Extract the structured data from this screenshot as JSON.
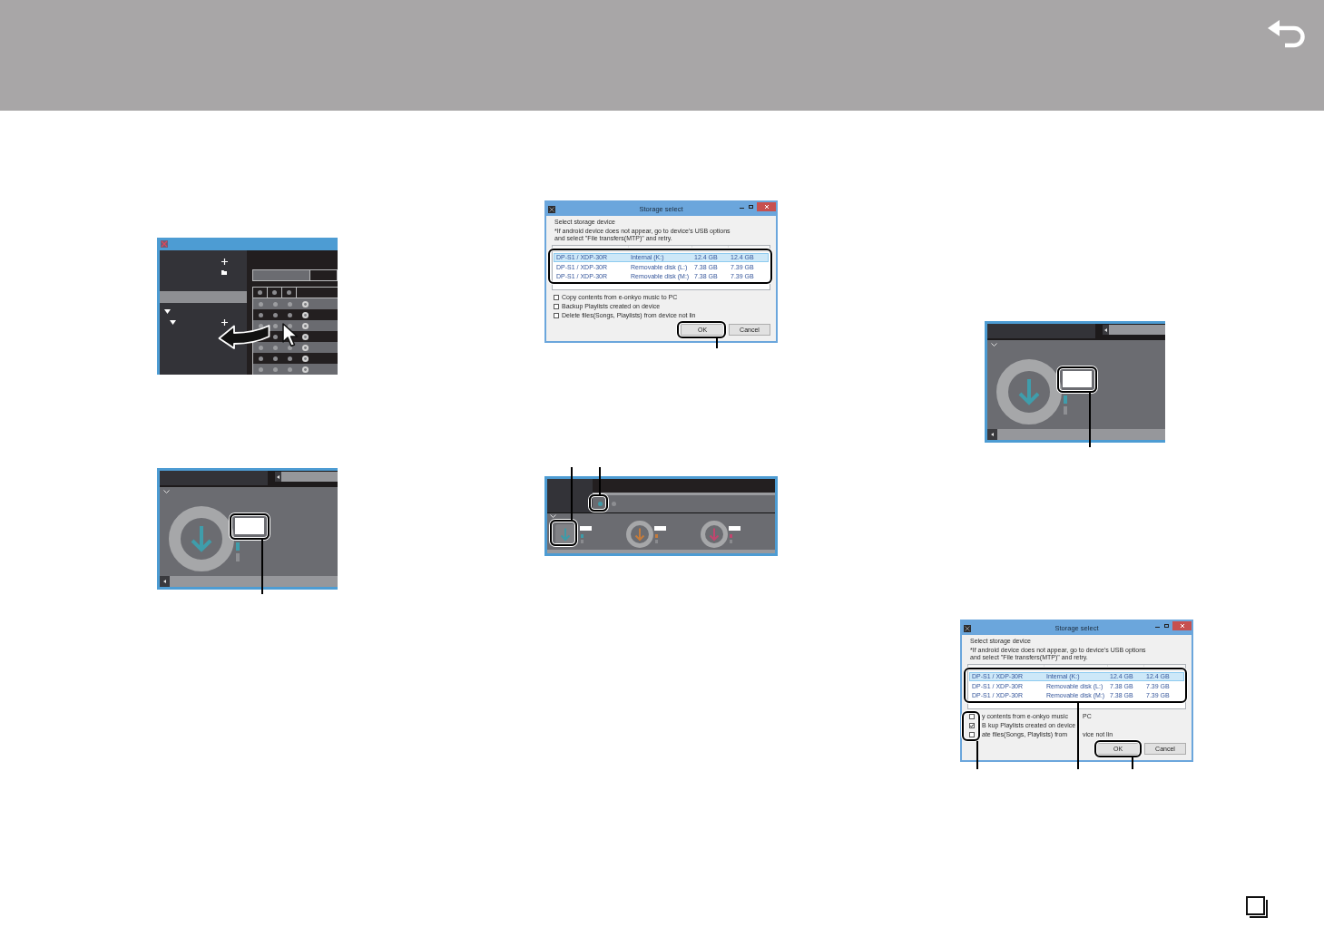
{
  "library_window": {
    "sidebar_items": [
      {
        "kind": "add",
        "selected": false
      },
      {
        "kind": "folder",
        "selected": false
      },
      {
        "kind": "row",
        "selected": true
      },
      {
        "kind": "expander",
        "selected": false
      },
      {
        "kind": "expander_add",
        "selected": false
      }
    ],
    "tabs": [
      {
        "selected": true
      },
      {
        "selected": false
      }
    ]
  },
  "storage_dialog_before": {
    "title": "Storage select",
    "instruction": "Select storage device",
    "note_lines": [
      "*If android device does not appear, go to device's USB options",
      "and select \"File transfers(MTP)\" and retry."
    ],
    "rows": [
      {
        "cells": [
          "DP-S1 / XDP-30R",
          "Internal (K:)",
          "12.4 GB",
          "12.4 GB"
        ],
        "selected": true
      },
      {
        "cells": [
          "DP-S1 / XDP-30R",
          "Removable disk (L:)",
          "7.38 GB",
          "7.39 GB"
        ],
        "selected": false
      },
      {
        "cells": [
          "DP-S1 / XDP-30R",
          "Removable disk (M:)",
          "7.38 GB",
          "7.39 GB"
        ],
        "selected": false
      }
    ],
    "checkboxes": [
      {
        "label_parts": [
          "Copy contents from e-onkyo music to PC"
        ],
        "checked": false
      },
      {
        "label_parts": [
          "Backup Playlists created on device"
        ],
        "checked": false
      },
      {
        "label_parts": [
          "Delete files(Songs, Playlists) from device not lin"
        ],
        "checked": false
      }
    ],
    "buttons": [
      {
        "kind": "ok",
        "label": "OK"
      },
      {
        "kind": "cancel",
        "label": "Cancel"
      }
    ]
  },
  "download_panel": {
    "sources": [
      {
        "selected": true
      },
      {
        "selected": false
      }
    ],
    "items": [
      {
        "color": "#3d9ba8",
        "selected": true
      },
      {
        "color": "#c47b3c",
        "selected": false
      },
      {
        "color": "#c0466e",
        "selected": false
      }
    ]
  },
  "storage_dialog_after": {
    "title": "Storage select",
    "instruction": "Select storage device",
    "note_lines": [
      "*If android device does not appear, go to device's USB options",
      "and select \"File transfers(MTP)\" and retry."
    ],
    "rows": [
      {
        "cells": [
          "DP-S1 / XDP-30R",
          "Internal (K:)",
          "12.4 GB",
          "12.4 GB"
        ],
        "selected": true
      },
      {
        "cells": [
          "DP-S1 / XDP-30R",
          "Removable disk (L:)",
          "7.38 GB",
          "7.39 GB"
        ],
        "selected": false
      },
      {
        "cells": [
          "DP-S1 / XDP-30R",
          "Removable disk (M:)",
          "7.38 GB",
          "7.39 GB"
        ],
        "selected": false
      }
    ],
    "checkboxes": [
      {
        "label_parts": [
          "y contents from e-onkyo music",
          "PC"
        ],
        "checked": false
      },
      {
        "label_parts": [
          "B",
          "kup Playlists created on device"
        ],
        "checked": true
      },
      {
        "label_parts": [
          "ate files(Songs, Playlists) from",
          "vice not lin"
        ],
        "checked": false
      }
    ],
    "buttons": [
      {
        "kind": "ok",
        "label": "OK"
      },
      {
        "kind": "cancel",
        "label": "Cancel"
      }
    ]
  }
}
